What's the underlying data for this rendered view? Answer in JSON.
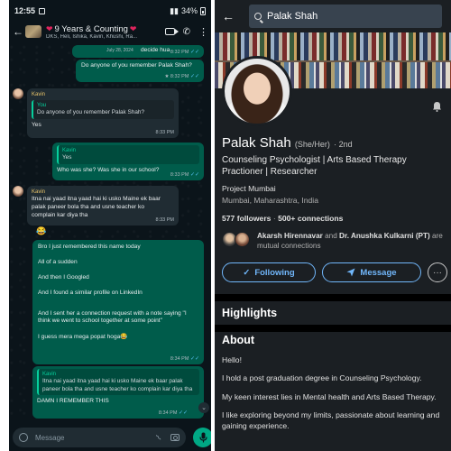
{
  "whatsapp": {
    "status_bar": {
      "time": "12:55",
      "battery": "34%"
    },
    "header": {
      "title": "9 Years & Counting",
      "members": "DKS, Heli, Ishika, Kavin, Khushi, Ra..."
    },
    "messages": {
      "m1": {
        "date": "July 28, 2024",
        "text": "decide hua",
        "time": "8:32 PM"
      },
      "m2": {
        "text": "Do anyone of you remember Palak Shah?",
        "time": "8:32 PM",
        "star": "★"
      },
      "m3": {
        "sender": "Kavin",
        "quote_name": "You",
        "quote_text": "Do anyone of you remember Palak Shah?",
        "text": "Yes",
        "time": "8:33 PM"
      },
      "m4": {
        "quote_name": "Kavin",
        "quote_text": "Yes",
        "text": "Who was she? Was she in our school?",
        "time": "8:33 PM"
      },
      "m5": {
        "sender": "Kavin",
        "text": "Itna nai yaad itna yaad hai ki usko Maine ek baar palak paneer bola tha and usne teacher ko complain kar diya tha",
        "time": "8:33 PM",
        "emoji": "😂"
      },
      "m6": {
        "lines": [
          "Bro I just remembered this name today",
          "All of a sudden",
          "And then I Googled",
          "And I found a similar profile on LinkedIn",
          "And I sent her a connection request with a note saying \"I think we went to school together at some point\"",
          "I guess mera mega popat hoga😂"
        ],
        "time": "8:34 PM"
      },
      "m7": {
        "quote_name": "Kavin",
        "quote_text": "Itna nai yaad itna yaad hai ki usko Maine ek baar palak paneer bola tha and usne teacher ko complain kar diya tha",
        "text": "DAMN I REMEMBER THIS",
        "time": "8:34 PM"
      }
    },
    "input": {
      "placeholder": "Message"
    }
  },
  "linkedin": {
    "search": {
      "value": "Palak Shah"
    },
    "profile": {
      "name": "Palak Shah",
      "pronouns": "(She/Her)",
      "degree": "· 2nd",
      "headline": "Counseling Psychologist | Arts Based Therapy Practioner | Researcher",
      "company": "Project Mumbai",
      "location": "Mumbai, Maharashtra, India",
      "followers": "577 followers",
      "connections": "500+ connections",
      "mutual_1": "Akarsh Hirennavar",
      "mutual_and": "and",
      "mutual_2": "Dr. Anushka Kulkarni (PT)",
      "mutual_suffix": "are mutual connections"
    },
    "buttons": {
      "follow": "Following",
      "message": "Message"
    },
    "sections": {
      "highlights": "Highlights",
      "about": "About",
      "about_paragraphs": [
        "Hello!",
        "I hold a post graduation degree in Counseling Psychology.",
        "My keen interest lies in Mental health and Arts Based Therapy.",
        "I like exploring beyond my limits, passionate about learning and gaining experience."
      ]
    }
  }
}
